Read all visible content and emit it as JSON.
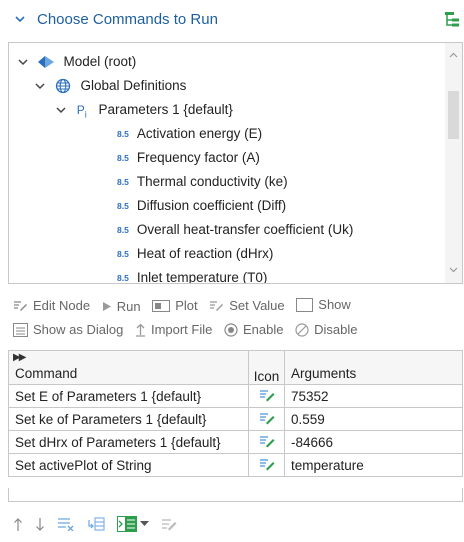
{
  "header": {
    "title": "Choose Commands to Run"
  },
  "tree": {
    "items": [
      {
        "label": "Model (root)"
      },
      {
        "label": "Global Definitions"
      },
      {
        "label": "Parameters 1 {default}"
      },
      {
        "label": "Activation energy (E)"
      },
      {
        "label": "Frequency factor (A)"
      },
      {
        "label": "Thermal conductivity (ke)"
      },
      {
        "label": "Diffusion coefficient (Diff)"
      },
      {
        "label": "Overall heat-transfer coefficient (Uk)"
      },
      {
        "label": "Heat of reaction (dHrx)"
      },
      {
        "label": "Inlet temperature (T0)"
      }
    ]
  },
  "toolbar": {
    "edit_node": "Edit Node",
    "run": "Run",
    "plot": "Plot",
    "set_value": "Set Value",
    "show": "Show",
    "show_as_dialog": "Show as Dialog",
    "import_file": "Import File",
    "enable": "Enable",
    "disable": "Disable"
  },
  "table": {
    "headers": {
      "command": "Command",
      "icon": "Icon",
      "arguments": "Arguments"
    },
    "rows": [
      {
        "command": "Set E of Parameters 1 {default}",
        "arguments": "75352"
      },
      {
        "command": "Set ke of Parameters 1 {default}",
        "arguments": "0.559"
      },
      {
        "command": "Set dHrx of Parameters 1 {default}",
        "arguments": "-84666"
      },
      {
        "command": "Set activePlot of String",
        "arguments": "temperature"
      }
    ]
  },
  "colors": {
    "accent": "#1d5f9e",
    "icon_blue": "#2b6fbc",
    "icon_green": "#2e9e4e"
  }
}
